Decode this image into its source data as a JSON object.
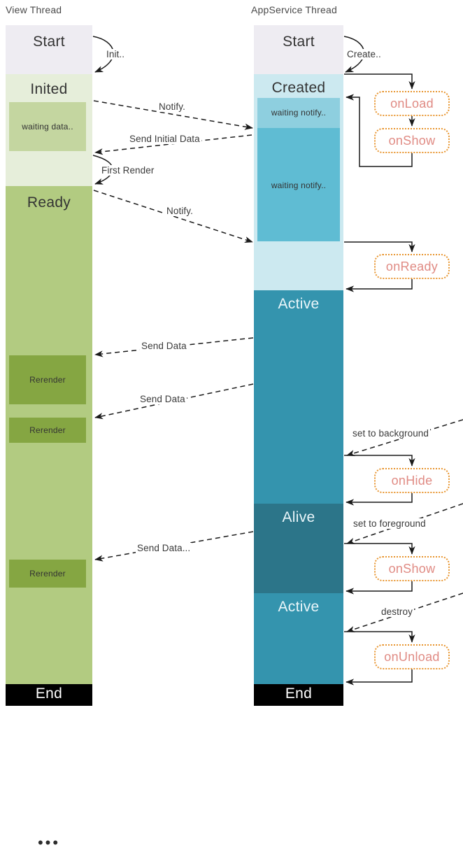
{
  "lanes": {
    "view": {
      "title": "View Thread"
    },
    "appservice": {
      "title": "AppService Thread"
    }
  },
  "view_states": {
    "start": "Start",
    "inited": "Inited",
    "waiting_data": "waiting data..",
    "ready": "Ready",
    "rerender_1": "Rerender",
    "rerender_2": "Rerender",
    "rerender_3": "Rerender",
    "ellipsis": "•••",
    "end": "End"
  },
  "appservice_states": {
    "start": "Start",
    "created": "Created",
    "waiting_notify_1": "waiting notify..",
    "waiting_notify_2": "waiting notify..",
    "active_1": "Active",
    "alive": "Alive",
    "active_2": "Active",
    "end": "End"
  },
  "callbacks": {
    "on_load": "onLoad",
    "on_show_1": "onShow",
    "on_ready": "onReady",
    "on_hide": "onHide",
    "on_show_2": "onShow",
    "on_unload": "onUnload"
  },
  "edges": {
    "init": "Init..",
    "create": "Create..",
    "notify_1": "Notify.",
    "send_initial_data": "Send Initial Data",
    "first_render": "First Render",
    "notify_2": "Notify.",
    "send_data_1": "Send Data",
    "send_data_2": "Send Data",
    "set_to_background": "set to background",
    "set_to_foreground": "set to foreground",
    "send_data_3": "Send Data...",
    "destroy": "destroy"
  },
  "colors": {
    "start_gray": "#EEECF2",
    "inited_pale_green": "#E6EEDA",
    "waiting_green": "#C4D6A0",
    "ready_green": "#B2CB81",
    "rerender_green": "#85A642",
    "created_pale_blue": "#CCE9F0",
    "waiting_notify_light": "#8ECFDF",
    "waiting_notify_dark": "#5FBCD3",
    "active_teal": "#3494AE",
    "alive_dark_teal": "#2C7589",
    "end_black": "#000000",
    "callout_border": "#E8952F",
    "callout_text": "#E08B84"
  }
}
